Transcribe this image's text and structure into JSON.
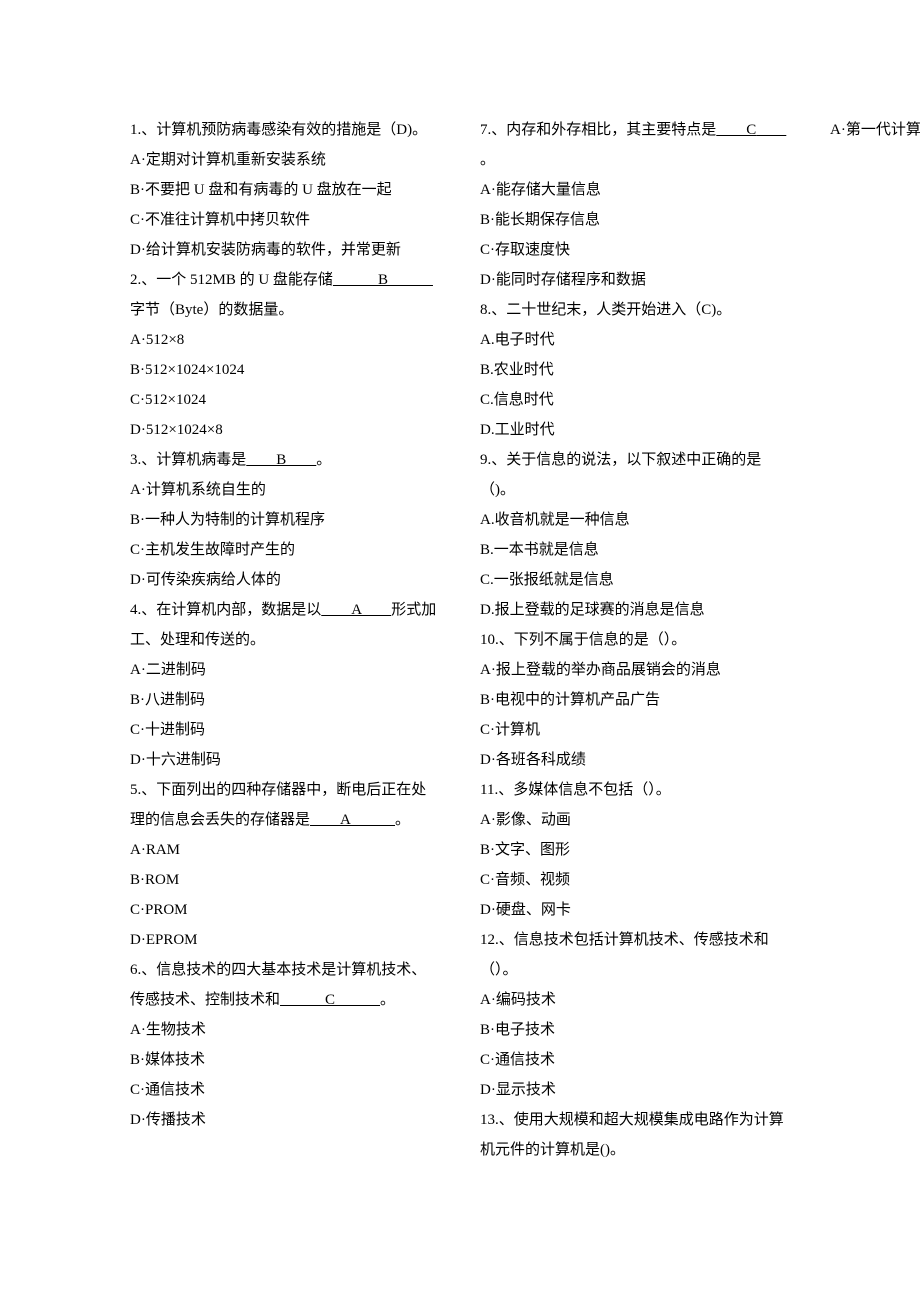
{
  "lines": [
    {
      "text": "1.、计算机预防病毒感染有效的措施是（D)。"
    },
    {
      "text": "A·定期对计算机重新安装系统"
    },
    {
      "text": "B·不要把 U 盘和有病毒的 U 盘放在一起"
    },
    {
      "text": "C·不准往计算机中拷贝软件"
    },
    {
      "text": "D·给计算机安装防病毒的软件，并常更新"
    },
    {
      "parts": [
        {
          "t": "2.、一个 512MB 的 U 盘能存储"
        },
        {
          "t": "　　　B　　　",
          "u": true
        },
        {
          "t": "字节（Byte）的数据量。"
        }
      ]
    },
    {
      "text": "A·512×8"
    },
    {
      "text": "B·512×1024×1024"
    },
    {
      "text": "C·512×1024"
    },
    {
      "text": "D·512×1024×8"
    },
    {
      "parts": [
        {
          "t": "3.、计算机病毒是"
        },
        {
          "t": "　　B　　",
          "u": true
        },
        {
          "t": "。"
        }
      ]
    },
    {
      "text": "A·计算机系统自生的"
    },
    {
      "text": "B·一种人为特制的计算机程序"
    },
    {
      "text": "C·主机发生故障时产生的"
    },
    {
      "text": "D·可传染疾病给人体的"
    },
    {
      "parts": [
        {
          "t": "4.、在计算机内部，数据是以"
        },
        {
          "t": "　　A　　",
          "u": true
        },
        {
          "t": "形式加工、处理和传送的。"
        }
      ]
    },
    {
      "text": "A·二进制码"
    },
    {
      "text": "B·八进制码"
    },
    {
      "text": "C·十进制码"
    },
    {
      "text": "D·十六进制码"
    },
    {
      "parts": [
        {
          "t": "5.、下面列出的四种存储器中，断电后正在处理的信息会丢失的存储器是"
        },
        {
          "t": "　　A　　　",
          "u": true
        },
        {
          "t": "。"
        }
      ]
    },
    {
      "text": "A·RAM"
    },
    {
      "text": "B·ROM"
    },
    {
      "text": "C·PROM"
    },
    {
      "text": "D·EPROM"
    },
    {
      "parts": [
        {
          "t": "6.、信息技术的四大基本技术是计算机技术、传感技术、控制技术和"
        },
        {
          "t": "　　　C　　　",
          "u": true
        },
        {
          "t": "。"
        }
      ]
    },
    {
      "text": "A·生物技术"
    },
    {
      "text": "B·媒体技术"
    },
    {
      "text": "C·通信技术"
    },
    {
      "text": "D·传播技术"
    },
    {
      "parts": [
        {
          "t": "7.、内存和外存相比，其主要特点是"
        },
        {
          "t": "　　C　　",
          "u": true
        },
        {
          "t": "。"
        }
      ]
    },
    {
      "text": "A·能存储大量信息"
    },
    {
      "text": "B·能长期保存信息"
    },
    {
      "text": "C·存取速度快"
    },
    {
      "text": "D·能同时存储程序和数据"
    },
    {
      "text": "8.、二十世纪末，人类开始进入（C)。"
    },
    {
      "text": "A.电子时代"
    },
    {
      "text": "B.农业时代"
    },
    {
      "text": "C.信息时代"
    },
    {
      "text": "D.工业时代"
    },
    {
      "text": "9.、关于信息的说法，以下叙述中正确的是（)。"
    },
    {
      "text": "A.收音机就是一种信息"
    },
    {
      "text": "B.一本书就是信息"
    },
    {
      "text": "C.一张报纸就是信息"
    },
    {
      "text": "D.报上登载的足球赛的消息是信息"
    },
    {
      "text": "10.、下列不属于信息的是（）。"
    },
    {
      "text": "A·报上登载的举办商品展销会的消息"
    },
    {
      "text": "B·电视中的计算机产品广告"
    },
    {
      "text": "C·计算机"
    },
    {
      "text": "D·各班各科成绩"
    },
    {
      "text": "11.、多媒体信息不包括（）。"
    },
    {
      "text": "A·影像、动画"
    },
    {
      "text": "B·文字、图形"
    },
    {
      "text": "C·音频、视频"
    },
    {
      "text": "D·硬盘、网卡"
    },
    {
      "text": "12.、信息技术包括计算机技术、传感技术和（）。"
    },
    {
      "text": "A·编码技术"
    },
    {
      "text": "B·电子技术"
    },
    {
      "text": "C·通信技术"
    },
    {
      "text": "D·显示技术"
    },
    {
      "text": "13.、使用大规模和超大规模集成电路作为计算机元件的计算机是()。"
    },
    {
      "text": "A·第一代计算机"
    }
  ]
}
